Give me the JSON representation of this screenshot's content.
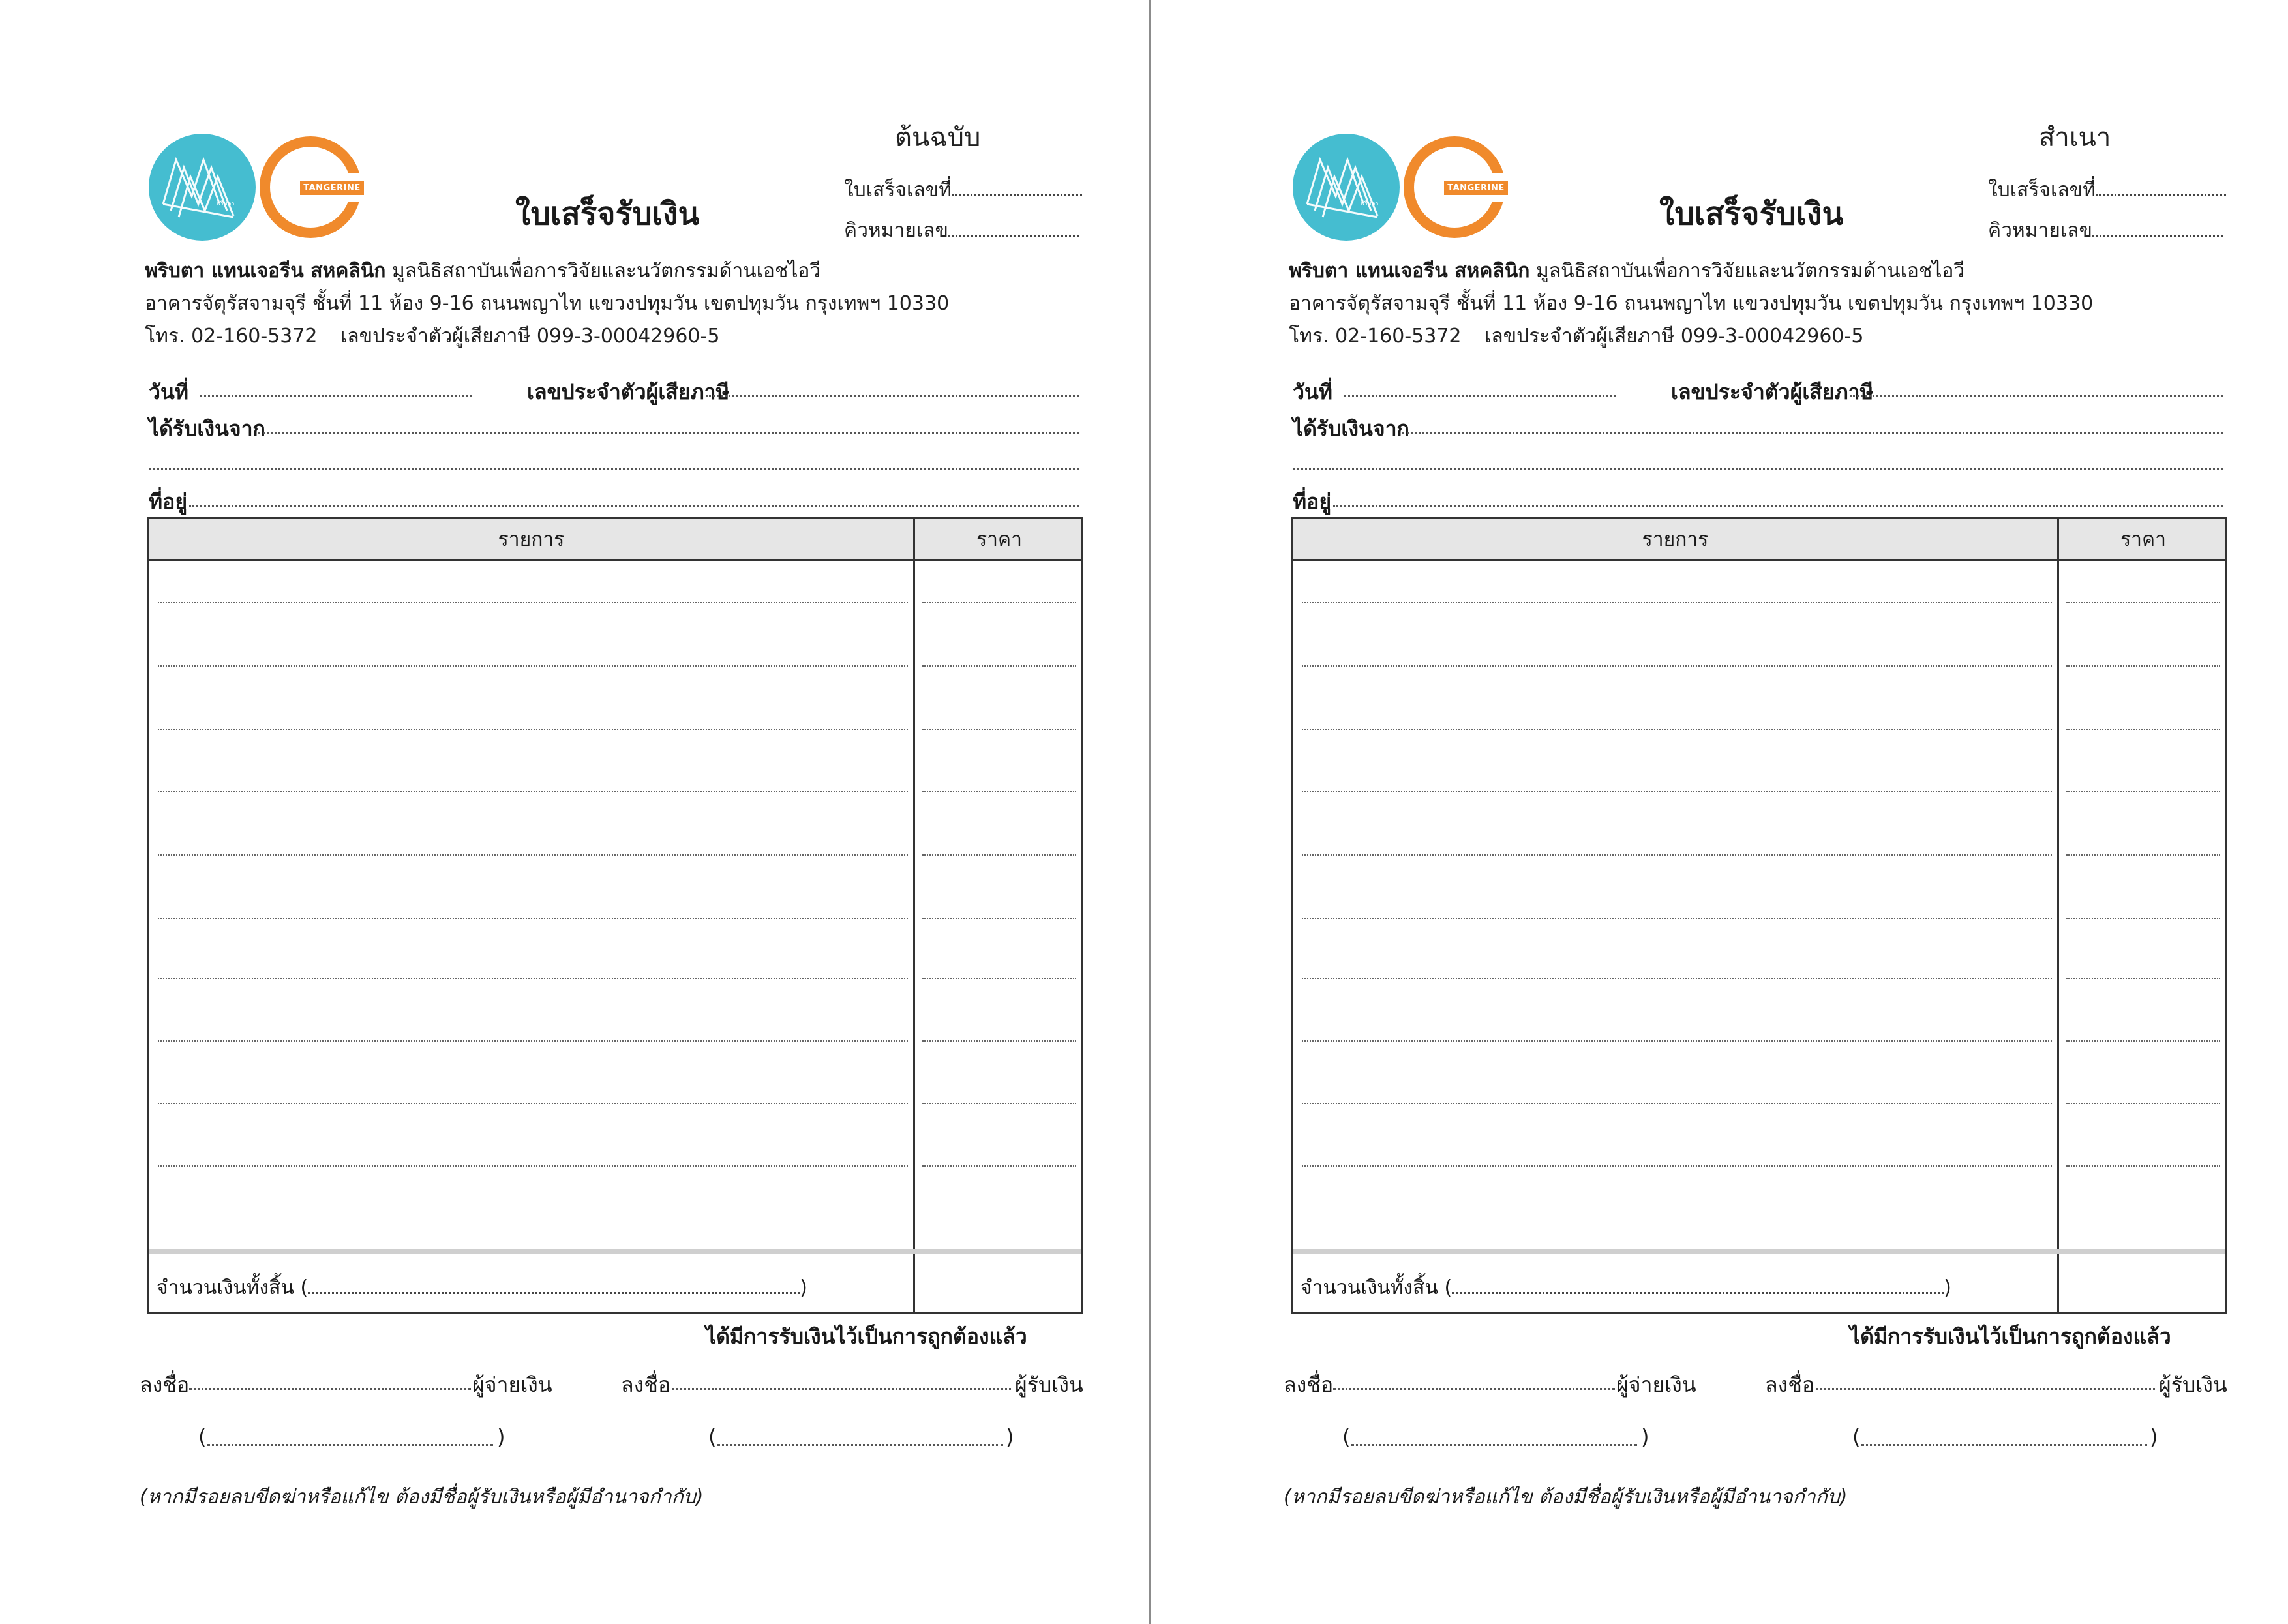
{
  "left_copy": {
    "label": "ต้นฉบับ"
  },
  "right_copy": {
    "label": "สำเนา"
  },
  "form": {
    "title": "ใบเสร็จรับเงิน",
    "receipt_no_label": "ใบเสร็จเลขที่",
    "queue_no_label": "คิวหมายเลข",
    "org_name_bold": "พริบตา แทนเจอรีน สหคลินิก",
    "org_name_rest": " มูลนิธิสถาบันเพื่อการวิจัยและนวัตกรรมด้านเอชไอวี",
    "address": "อาคารจัตุรัสจามจุรี ชั้นที่ 11 ห้อง 9-16 ถนนพญาไท แขวงปทุมวัน เขตปทุมวัน กรุงเทพฯ 10330",
    "phone": "โทร. 02-160-5372",
    "tax_id": "เลขประจำตัวผู้เสียภาษี 099-3-00042960-5",
    "date_label": "วันที่",
    "payer_tax_label": "เลขประจำตัวผู้เสียภาษี",
    "received_from_label": "ได้รับเงินจาก",
    "address_label": "ที่อยู่",
    "col_item": "รายการ",
    "col_price": "ราคา",
    "total_label": "จำนวนเงินทั้งสิ้น (",
    "total_close": ")",
    "received_statement": "ได้มีการรับเงินไว้เป็นการถูกต้องแล้ว",
    "sign_label": "ลงชื่อ",
    "payer_label": "ผู้จ่ายเงิน",
    "receiver_label": "ผู้รับเงิน",
    "paren_open": "(",
    "paren_close": ")",
    "note": "(หากมีรอยลบขีดฆ่าหรือแก้ไข ต้องมีชื่อผู้รับเงินหรือผู้มีอำนาจกำกับ)"
  },
  "logos": {
    "logo1_name": "พริบตา",
    "logo2_name": "TANGERINE",
    "logo1_color": "#45bdd0",
    "logo2_color": "#f08a2c"
  }
}
